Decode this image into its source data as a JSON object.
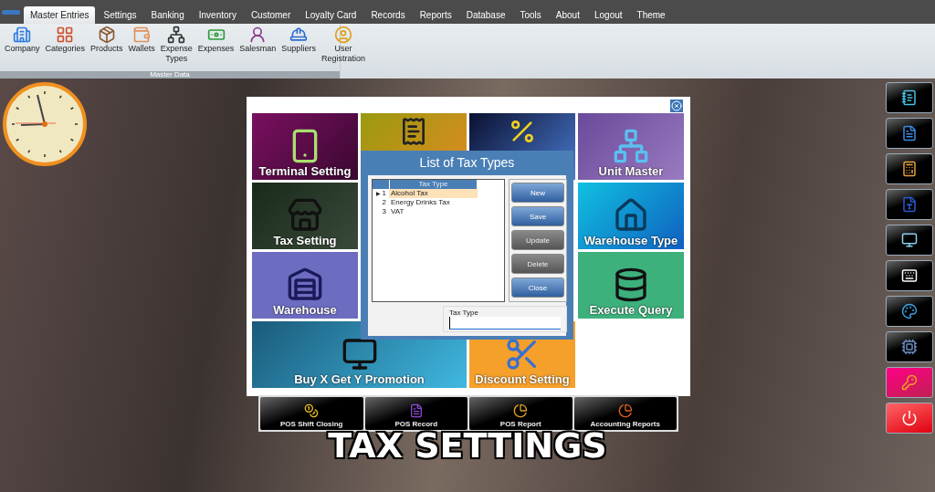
{
  "menu": {
    "tabs": [
      {
        "label": "Master Entries",
        "selected": true
      },
      {
        "label": "Settings",
        "selected": false
      },
      {
        "label": "Banking",
        "selected": false
      },
      {
        "label": "Inventory",
        "selected": false
      },
      {
        "label": "Customer",
        "selected": false
      },
      {
        "label": "Loyalty Card",
        "selected": false
      },
      {
        "label": "Records",
        "selected": false
      },
      {
        "label": "Reports",
        "selected": false
      },
      {
        "label": "Database",
        "selected": false
      },
      {
        "label": "Tools",
        "selected": false
      },
      {
        "label": "About",
        "selected": false
      },
      {
        "label": "Logout",
        "selected": false
      },
      {
        "label": "Theme",
        "selected": false
      }
    ]
  },
  "ribbon": {
    "group": "Master Data",
    "items": [
      {
        "label": "Company"
      },
      {
        "label": "Categories"
      },
      {
        "label": "Products"
      },
      {
        "label": "Wallets"
      },
      {
        "label": "Expense Types"
      },
      {
        "label": "Expenses"
      },
      {
        "label": "Salesman"
      },
      {
        "label": "Suppliers"
      },
      {
        "label": "User Registration"
      }
    ]
  },
  "tiles": [
    {
      "kind": "labelled",
      "label": "Terminal Setting"
    },
    {
      "kind": "covered"
    },
    {
      "kind": "covered"
    },
    {
      "kind": "labelled",
      "label": "Unit Master"
    },
    {
      "kind": "labelled",
      "label": "Tax Setting"
    },
    {
      "kind": "labelled",
      "label": "Warehouse Type"
    },
    {
      "kind": "labelled",
      "label": "Warehouse"
    },
    {
      "kind": "labelled",
      "label": "Execute Query"
    },
    {
      "kind": "labelled",
      "label": "Buy X Get Y Promotion"
    },
    {
      "kind": "labelled",
      "label": "Discount Setting"
    }
  ],
  "dialog": {
    "title": "List of Tax Types",
    "table": {
      "columns": [
        "Tax Type"
      ],
      "rows": [
        {
          "number": "1",
          "tax_type": "Alcohol Tax",
          "selected": true,
          "marker": "▶"
        },
        {
          "number": "2",
          "tax_type": "Energy Drinks Tax",
          "selected": false
        },
        {
          "number": "3",
          "tax_type": "VAT",
          "selected": false
        }
      ]
    },
    "buttons": [
      {
        "label": "New",
        "disabled": false
      },
      {
        "label": "Save",
        "disabled": false
      },
      {
        "label": "Update",
        "disabled": true
      },
      {
        "label": "Delete",
        "disabled": true
      },
      {
        "label": "Close",
        "disabled": false
      }
    ],
    "field": {
      "label": "Tax Type"
    }
  },
  "bottom_tiles": [
    {
      "label": "POS Shift Closing"
    },
    {
      "label": "POS Record"
    },
    {
      "label": "POS Report"
    },
    {
      "label": "Accounting Reports"
    }
  ],
  "sidebar": [
    {
      "kind": "dark"
    },
    {
      "kind": "dark"
    },
    {
      "kind": "dark"
    },
    {
      "kind": "dark"
    },
    {
      "kind": "dark"
    },
    {
      "kind": "dark"
    },
    {
      "kind": "dark"
    },
    {
      "kind": "dark"
    },
    {
      "kind": "pink"
    },
    {
      "kind": "red"
    }
  ],
  "caption": "TAX SETTINGS"
}
